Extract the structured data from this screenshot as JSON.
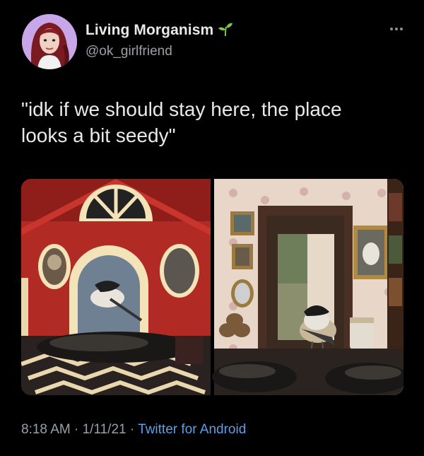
{
  "author": {
    "display_name": "Living Morganism",
    "handle": "@ok_girlfriend",
    "badge_icon": "sprout-icon",
    "badge_color": "#7ac943"
  },
  "tweet": {
    "text": "\"idk if we should stay here, the place\nlooks a bit seedy\""
  },
  "media": {
    "count": 2,
    "images": [
      {
        "name": "red-birdhouse-photo"
      },
      {
        "name": "dollhouse-room-chickadee-photo"
      }
    ]
  },
  "meta": {
    "time": "8:18 AM",
    "separator": " · ",
    "date": "1/11/21",
    "source": "Twitter for Android",
    "source_color": "#5d9ee6"
  },
  "colors": {
    "background": "#000000",
    "text": "#e7e9ea",
    "secondary": "#9aa0a6"
  }
}
